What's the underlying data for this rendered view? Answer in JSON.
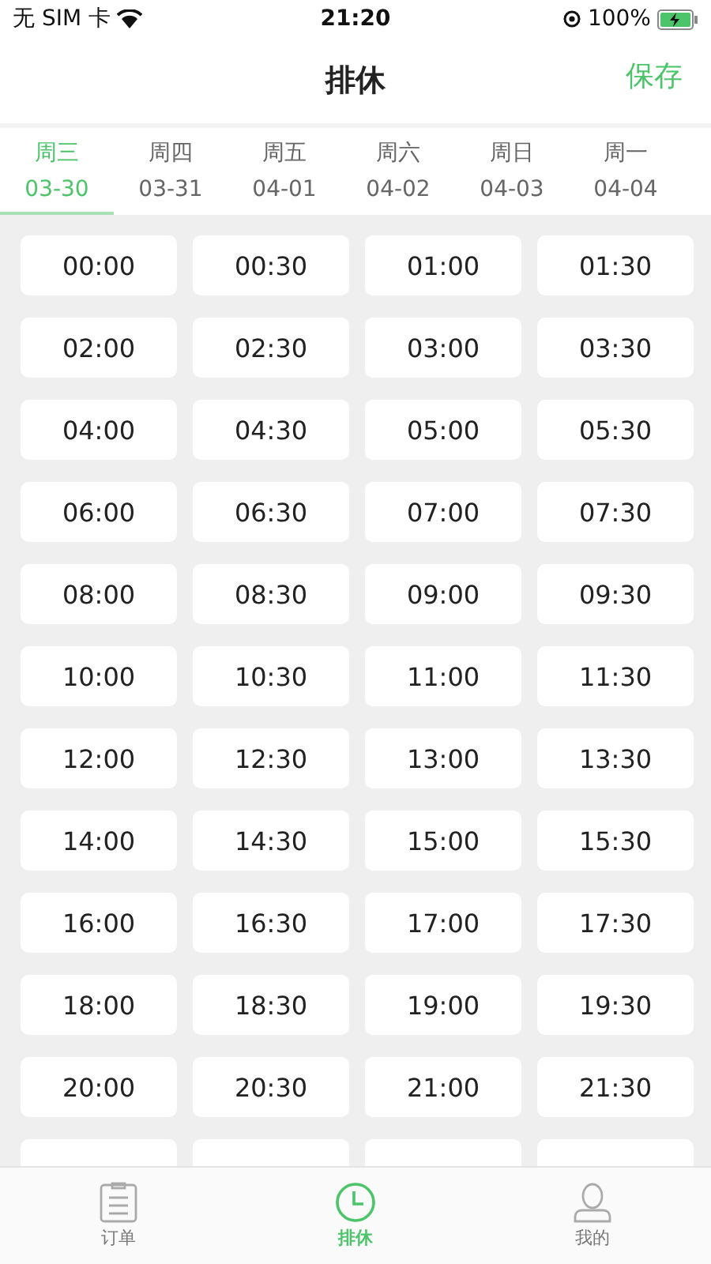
{
  "status_bar": {
    "carrier": "无 SIM 卡",
    "time": "21:20",
    "battery": "100%"
  },
  "nav": {
    "title": "排休",
    "action": "保存"
  },
  "days": [
    {
      "weekday": "周三",
      "date": "03-30",
      "selected": true
    },
    {
      "weekday": "周四",
      "date": "03-31",
      "selected": false
    },
    {
      "weekday": "周五",
      "date": "04-01",
      "selected": false
    },
    {
      "weekday": "周六",
      "date": "04-02",
      "selected": false
    },
    {
      "weekday": "周日",
      "date": "04-03",
      "selected": false
    },
    {
      "weekday": "周一",
      "date": "04-04",
      "selected": false
    }
  ],
  "slots": [
    {
      "time": "00:00",
      "selected": false
    },
    {
      "time": "00:30",
      "selected": false
    },
    {
      "time": "01:00",
      "selected": false
    },
    {
      "time": "01:30",
      "selected": false
    },
    {
      "time": "02:00",
      "selected": false
    },
    {
      "time": "02:30",
      "selected": false
    },
    {
      "time": "03:00",
      "selected": false
    },
    {
      "time": "03:30",
      "selected": false
    },
    {
      "time": "04:00",
      "selected": false
    },
    {
      "time": "04:30",
      "selected": false
    },
    {
      "time": "05:00",
      "selected": false
    },
    {
      "time": "05:30",
      "selected": false
    },
    {
      "time": "06:00",
      "selected": false
    },
    {
      "time": "06:30",
      "selected": false
    },
    {
      "time": "07:00",
      "selected": false
    },
    {
      "time": "07:30",
      "selected": false
    },
    {
      "time": "08:00",
      "selected": false
    },
    {
      "time": "08:30",
      "selected": false
    },
    {
      "time": "09:00",
      "selected": false
    },
    {
      "time": "09:30",
      "selected": false
    },
    {
      "time": "10:00",
      "selected": false
    },
    {
      "time": "10:30",
      "selected": false
    },
    {
      "time": "11:00",
      "selected": false
    },
    {
      "time": "11:30",
      "selected": false
    },
    {
      "time": "12:00",
      "selected": false
    },
    {
      "time": "12:30",
      "selected": false
    },
    {
      "time": "13:00",
      "selected": false
    },
    {
      "time": "13:30",
      "selected": false
    },
    {
      "time": "14:00",
      "selected": false
    },
    {
      "time": "14:30",
      "selected": false
    },
    {
      "time": "15:00",
      "selected": false
    },
    {
      "time": "15:30",
      "selected": false
    },
    {
      "time": "16:00",
      "selected": false
    },
    {
      "time": "16:30",
      "selected": false
    },
    {
      "time": "17:00",
      "selected": false
    },
    {
      "time": "17:30",
      "selected": false
    },
    {
      "time": "18:00",
      "selected": false
    },
    {
      "time": "18:30",
      "selected": false
    },
    {
      "time": "19:00",
      "selected": false
    },
    {
      "time": "19:30",
      "selected": false
    },
    {
      "time": "20:00",
      "selected": false
    },
    {
      "time": "20:30",
      "selected": false
    },
    {
      "time": "21:00",
      "selected": false
    },
    {
      "time": "21:30",
      "selected": false
    }
  ],
  "tab_bar": [
    {
      "kind": "orders",
      "label": "订单",
      "selected": false
    },
    {
      "kind": "schedule",
      "label": "排休",
      "selected": true
    },
    {
      "kind": "profile",
      "label": "我的",
      "selected": false
    }
  ]
}
